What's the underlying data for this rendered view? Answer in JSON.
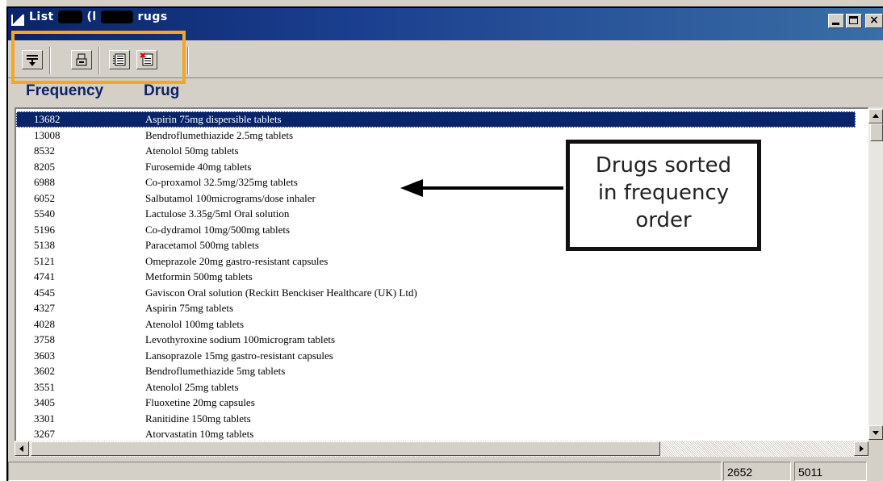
{
  "window": {
    "title_start": "List",
    "title_mid": "(l",
    "title_end": "rugs",
    "minimize_label": "",
    "maximize_label": "",
    "close_label": "×"
  },
  "toolbar": {
    "buttons": [
      {
        "icon": "move-down-icon"
      },
      {
        "icon": "print-icon"
      },
      {
        "icon": "list-icon"
      },
      {
        "icon": "delete-list-icon"
      }
    ],
    "highlight_color": "#f5a623"
  },
  "columns": {
    "frequency": "Frequency",
    "drug": "Drug"
  },
  "rows": [
    {
      "frequency": "13682",
      "drug": "Aspirin 75mg dispersible tablets",
      "selected": true
    },
    {
      "frequency": "13008",
      "drug": "Bendroflumethiazide 2.5mg tablets"
    },
    {
      "frequency": "8532",
      "drug": "Atenolol 50mg tablets"
    },
    {
      "frequency": "8205",
      "drug": "Furosemide 40mg tablets"
    },
    {
      "frequency": "6988",
      "drug": "Co-proxamol 32.5mg/325mg tablets"
    },
    {
      "frequency": "6052",
      "drug": "Salbutamol 100micrograms/dose inhaler"
    },
    {
      "frequency": "5540",
      "drug": "Lactulose 3.35g/5ml Oral solution"
    },
    {
      "frequency": "5196",
      "drug": "Co-dydramol 10mg/500mg tablets"
    },
    {
      "frequency": "5138",
      "drug": "Paracetamol 500mg tablets"
    },
    {
      "frequency": "5121",
      "drug": "Omeprazole 20mg gastro-resistant capsules"
    },
    {
      "frequency": "4741",
      "drug": "Metformin 500mg tablets"
    },
    {
      "frequency": "4545",
      "drug": "Gaviscon Oral solution (Reckitt Benckiser Healthcare (UK) Ltd)"
    },
    {
      "frequency": "4327",
      "drug": "Aspirin 75mg tablets"
    },
    {
      "frequency": "4028",
      "drug": "Atenolol 100mg tablets"
    },
    {
      "frequency": "3758",
      "drug": "Levothyroxine sodium 100microgram tablets"
    },
    {
      "frequency": "3603",
      "drug": "Lansoprazole 15mg gastro-resistant capsules"
    },
    {
      "frequency": "3602",
      "drug": "Bendroflumethiazide 5mg tablets"
    },
    {
      "frequency": "3551",
      "drug": "Atenolol 25mg tablets"
    },
    {
      "frequency": "3405",
      "drug": "Fluoxetine 20mg capsules"
    },
    {
      "frequency": "3301",
      "drug": "Ranitidine 150mg tablets"
    },
    {
      "frequency": "3267",
      "drug": "Atorvastatin 10mg tablets"
    }
  ],
  "callout": {
    "lines": [
      "Drugs sorted",
      "in frequency",
      "order"
    ]
  },
  "status": {
    "left_value": "2652",
    "right_value": "5011"
  },
  "colors": {
    "title_bar": "#0a246a",
    "selection": "#0a246a",
    "header_text": "#0a246a",
    "chrome": "#d4d0c8"
  }
}
